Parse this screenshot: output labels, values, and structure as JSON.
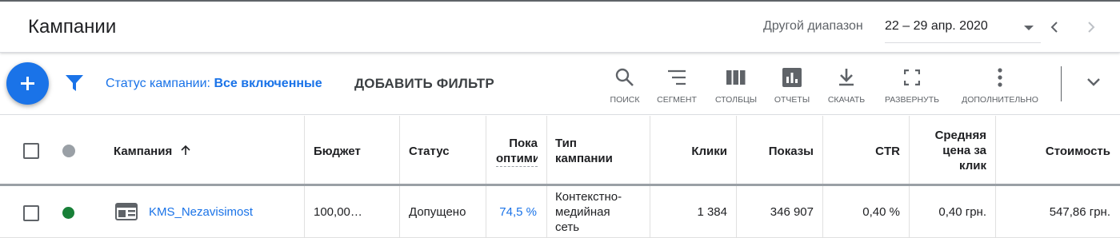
{
  "header": {
    "title": "Кампании",
    "range_label": "Другой диапазон",
    "range_value": "22 – 29 апр. 2020"
  },
  "toolbar": {
    "filter_label": "Статус кампании:",
    "filter_value": "Все включенные",
    "add_filter": "ДОБАВИТЬ ФИЛЬТР",
    "tools": {
      "search": "ПОИСК",
      "segment": "СЕГМЕНТ",
      "columns": "СТОЛБЦЫ",
      "reports": "ОТЧЕТЫ",
      "download": "СКАЧАТЬ",
      "expand": "РАЗВЕРНУТЬ",
      "more": "ДОПОЛНИТЕЛЬНО"
    }
  },
  "table": {
    "headers": {
      "campaign": "Кампания",
      "budget": "Бюджет",
      "status": "Статус",
      "optimization_1": "Пока",
      "optimization_2": "оптими",
      "type_1": "Тип",
      "type_2": "кампании",
      "clicks": "Клики",
      "impressions": "Показы",
      "ctr": "CTR",
      "cpc_1": "Средняя",
      "cpc_2": "цена за",
      "cpc_3": "клик",
      "cost": "Стоимость"
    },
    "rows": [
      {
        "campaign": "KMS_Nezavisimost",
        "budget": "100,00…",
        "status": "Допущено",
        "optimization": "74,5 %",
        "type_1": "Контекстно-",
        "type_2": "медийная",
        "type_3": "сеть",
        "clicks": "1 384",
        "impressions": "346 907",
        "ctr": "0,40 %",
        "cpc": "0,40 грн.",
        "cost": "547,86 грн."
      }
    ]
  },
  "colors": {
    "accent": "#1a73e8",
    "status_enabled": "#188038",
    "status_header_dot": "#9aa0a6"
  },
  "icons": {
    "fab": "plus-icon",
    "filter": "filter-icon",
    "search": "search-icon",
    "segment": "segment-icon",
    "columns": "columns-icon",
    "reports": "reports-icon",
    "download": "download-icon",
    "expand": "fullscreen-icon",
    "more": "more-vert-icon",
    "campaign_type": "display-campaign-icon"
  }
}
